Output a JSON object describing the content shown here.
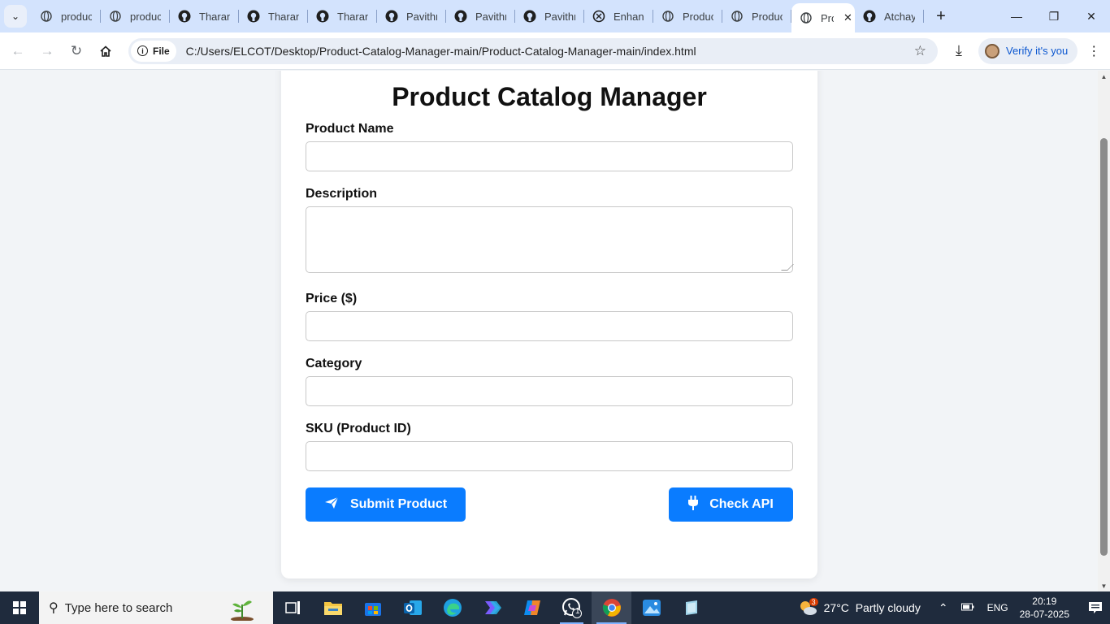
{
  "tabs": [
    {
      "label": "produc",
      "icon": "globe-icon"
    },
    {
      "label": "produc",
      "icon": "globe-icon"
    },
    {
      "label": "Tharan",
      "icon": "github-icon"
    },
    {
      "label": "Tharan",
      "icon": "github-icon"
    },
    {
      "label": "Tharan",
      "icon": "github-icon"
    },
    {
      "label": "Pavithr",
      "icon": "github-icon"
    },
    {
      "label": "Pavithr",
      "icon": "github-icon"
    },
    {
      "label": "Pavithr",
      "icon": "github-icon"
    },
    {
      "label": "Enhanc",
      "icon": "openai-icon"
    },
    {
      "label": "Produc",
      "icon": "globe-icon"
    },
    {
      "label": "Produc",
      "icon": "globe-icon"
    },
    {
      "label": "Pro",
      "icon": "globe-icon",
      "active": true
    },
    {
      "label": "Atchay",
      "icon": "github-icon"
    }
  ],
  "toolbar": {
    "chip_label": "File",
    "url": "C:/Users/ELCOT/Desktop/Product-Catalog-Manager-main/Product-Catalog-Manager-main/index.html",
    "verify_label": "Verify it's you"
  },
  "form": {
    "title": "Product Catalog Manager",
    "fields": {
      "name_label": "Product Name",
      "description_label": "Description",
      "price_label": "Price ($)",
      "category_label": "Category",
      "sku_label": "SKU (Product ID)"
    },
    "submit_label": "Submit Product",
    "check_api_label": "Check API"
  },
  "taskbar": {
    "search_placeholder": "Type here to search",
    "weather": "27°C  Partly cloudy",
    "weather_badge": "3",
    "language": "ENG",
    "time": "20:19",
    "date": "28-07-2025",
    "whatsapp_badge": "1"
  },
  "colors": {
    "accent": "#0a7cff",
    "tabstrip": "#d3e3fd",
    "taskbar": "#1f2b3d"
  }
}
